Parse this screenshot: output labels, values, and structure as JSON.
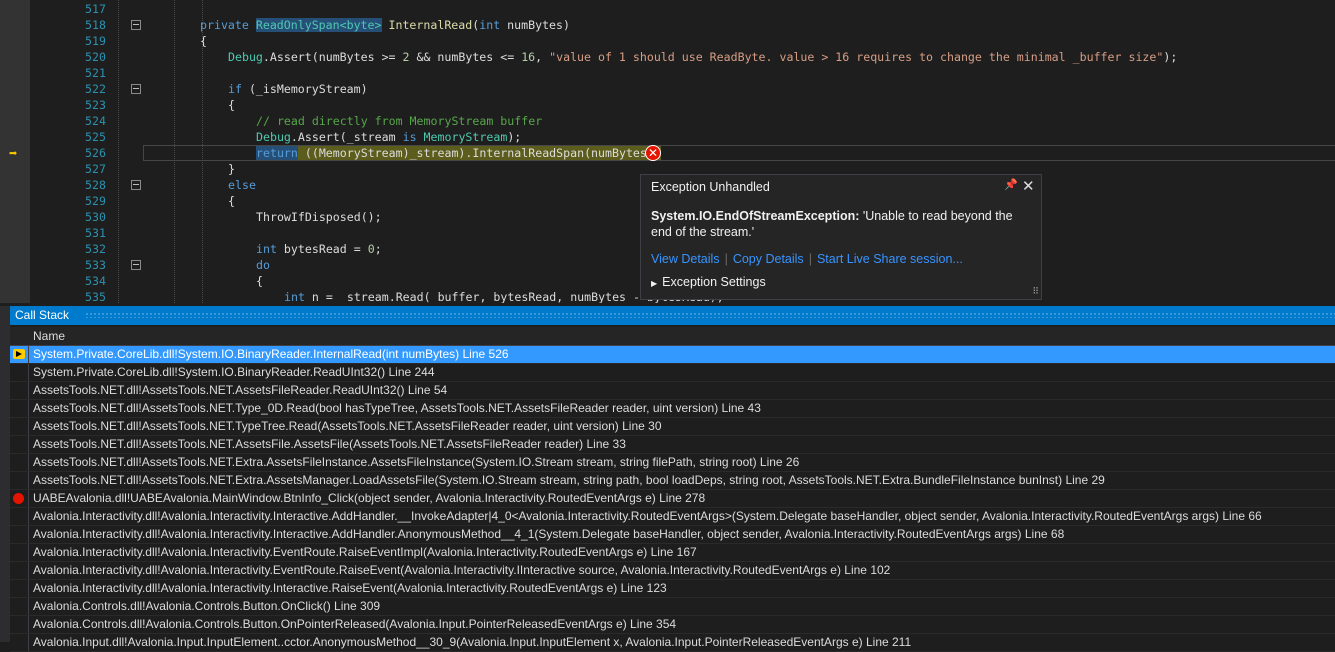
{
  "editor": {
    "lines": [
      {
        "no": "517"
      },
      {
        "no": "518"
      },
      {
        "no": "519"
      },
      {
        "no": "520"
      },
      {
        "no": "521"
      },
      {
        "no": "522"
      },
      {
        "no": "523"
      },
      {
        "no": "524"
      },
      {
        "no": "525"
      },
      {
        "no": "526"
      },
      {
        "no": "527"
      },
      {
        "no": "528"
      },
      {
        "no": "529"
      },
      {
        "no": "530"
      },
      {
        "no": "531"
      },
      {
        "no": "532"
      },
      {
        "no": "533"
      },
      {
        "no": "534"
      },
      {
        "no": "535"
      }
    ],
    "tokens": {
      "l518_private": "private",
      "l518_type": "ReadOnlySpan<byte>",
      "l518_name": "InternalRead",
      "l518_args_open": "(",
      "l518_int": "int",
      "l518_args_rest": " numBytes)",
      "l519": "{",
      "l520_debug": "Debug",
      "l520_assert": ".Assert(numBytes >= ",
      "l520_n2": "2",
      "l520_and": " && numBytes <= ",
      "l520_n16": "16",
      "l520_comma": ", ",
      "l520_str": "\"value of 1 should use ReadByte. value > 16 requires to change the minimal _buffer size\"",
      "l520_end": ");",
      "l522_if": "if",
      "l522_rest": " (_isMemoryStream)",
      "l523": "{",
      "l524_comment": "// read directly from MemoryStream buffer",
      "l525_debug": "Debug",
      "l525_assert": ".Assert(_stream ",
      "l525_is": "is",
      "l525_sp": " ",
      "l525_ms": "MemoryStream",
      "l525_end": ");",
      "l526_return": "return",
      "l526_rest": " ((MemoryStream)_stream).InternalReadSpan(numBytes);",
      "l527": "}",
      "l528_else": "else",
      "l529": "{",
      "l530": "ThrowIfDisposed();",
      "l532_int": "int",
      "l532_rest": " bytesRead = ",
      "l532_zero": "0",
      "l532_end": ";",
      "l533_do": "do",
      "l534": "{",
      "l535_int": "int",
      "l535_rest": " n = _stream.Read(_buffer, bytesRead, numBytes - bytesRead);"
    }
  },
  "exception_popup": {
    "title": "Exception Unhandled",
    "exception_type": "System.IO.EndOfStreamException:",
    "message": " 'Unable to read beyond the end of the stream.'",
    "view_details": "View Details",
    "copy_details": "Copy Details",
    "live_share": "Start Live Share session...",
    "exception_settings": "Exception Settings",
    "pin_icon": "pin-icon",
    "close_icon": "close-icon"
  },
  "call_stack": {
    "title": "Call Stack",
    "column_name": "Name",
    "rows": [
      {
        "text": "System.Private.CoreLib.dll!System.IO.BinaryReader.InternalRead(int numBytes) Line 526",
        "icon": "current-frame-arrow-icon"
      },
      {
        "text": "System.Private.CoreLib.dll!System.IO.BinaryReader.ReadUInt32() Line 244",
        "icon": ""
      },
      {
        "text": "AssetsTools.NET.dll!AssetsTools.NET.AssetsFileReader.ReadUInt32() Line 54",
        "icon": ""
      },
      {
        "text": "AssetsTools.NET.dll!AssetsTools.NET.Type_0D.Read(bool hasTypeTree, AssetsTools.NET.AssetsFileReader reader, uint version) Line 43",
        "icon": ""
      },
      {
        "text": "AssetsTools.NET.dll!AssetsTools.NET.TypeTree.Read(AssetsTools.NET.AssetsFileReader reader, uint version) Line 30",
        "icon": ""
      },
      {
        "text": "AssetsTools.NET.dll!AssetsTools.NET.AssetsFile.AssetsFile(AssetsTools.NET.AssetsFileReader reader) Line 33",
        "icon": ""
      },
      {
        "text": "AssetsTools.NET.dll!AssetsTools.NET.Extra.AssetsFileInstance.AssetsFileInstance(System.IO.Stream stream, string filePath, string root) Line 26",
        "icon": ""
      },
      {
        "text": "AssetsTools.NET.dll!AssetsTools.NET.Extra.AssetsManager.LoadAssetsFile(System.IO.Stream stream, string path, bool loadDeps, string root, AssetsTools.NET.Extra.BundleFileInstance bunInst) Line 29",
        "icon": ""
      },
      {
        "text": "UABEAvalonia.dll!UABEAvalonia.MainWindow.BtnInfo_Click(object sender, Avalonia.Interactivity.RoutedEventArgs e) Line 278",
        "icon": "breakpoint-icon"
      },
      {
        "text": "Avalonia.Interactivity.dll!Avalonia.Interactivity.Interactive.AddHandler.__InvokeAdapter|4_0<Avalonia.Interactivity.RoutedEventArgs>(System.Delegate baseHandler, object sender, Avalonia.Interactivity.RoutedEventArgs args) Line 66",
        "icon": ""
      },
      {
        "text": "Avalonia.Interactivity.dll!Avalonia.Interactivity.Interactive.AddHandler.AnonymousMethod__4_1(System.Delegate baseHandler, object sender, Avalonia.Interactivity.RoutedEventArgs args) Line 68",
        "icon": ""
      },
      {
        "text": "Avalonia.Interactivity.dll!Avalonia.Interactivity.EventRoute.RaiseEventImpl(Avalonia.Interactivity.RoutedEventArgs e) Line 167",
        "icon": ""
      },
      {
        "text": "Avalonia.Interactivity.dll!Avalonia.Interactivity.EventRoute.RaiseEvent(Avalonia.Interactivity.IInteractive source, Avalonia.Interactivity.RoutedEventArgs e) Line 102",
        "icon": ""
      },
      {
        "text": "Avalonia.Interactivity.dll!Avalonia.Interactivity.Interactive.RaiseEvent(Avalonia.Interactivity.RoutedEventArgs e) Line 123",
        "icon": ""
      },
      {
        "text": "Avalonia.Controls.dll!Avalonia.Controls.Button.OnClick() Line 309",
        "icon": ""
      },
      {
        "text": "Avalonia.Controls.dll!Avalonia.Controls.Button.OnPointerReleased(Avalonia.Input.PointerReleasedEventArgs e) Line 354",
        "icon": ""
      },
      {
        "text": "Avalonia.Input.dll!Avalonia.Input.InputElement..cctor.AnonymousMethod__30_9(Avalonia.Input.InputElement x, Avalonia.Input.PointerReleasedEventArgs e) Line 211",
        "icon": ""
      }
    ]
  },
  "colors": {
    "accent": "#007acc",
    "selection": "#3399ff",
    "error": "#e51400",
    "keyword": "#569cd6",
    "type": "#4ec9b0",
    "string": "#d69d85",
    "comment": "#57a64a"
  }
}
